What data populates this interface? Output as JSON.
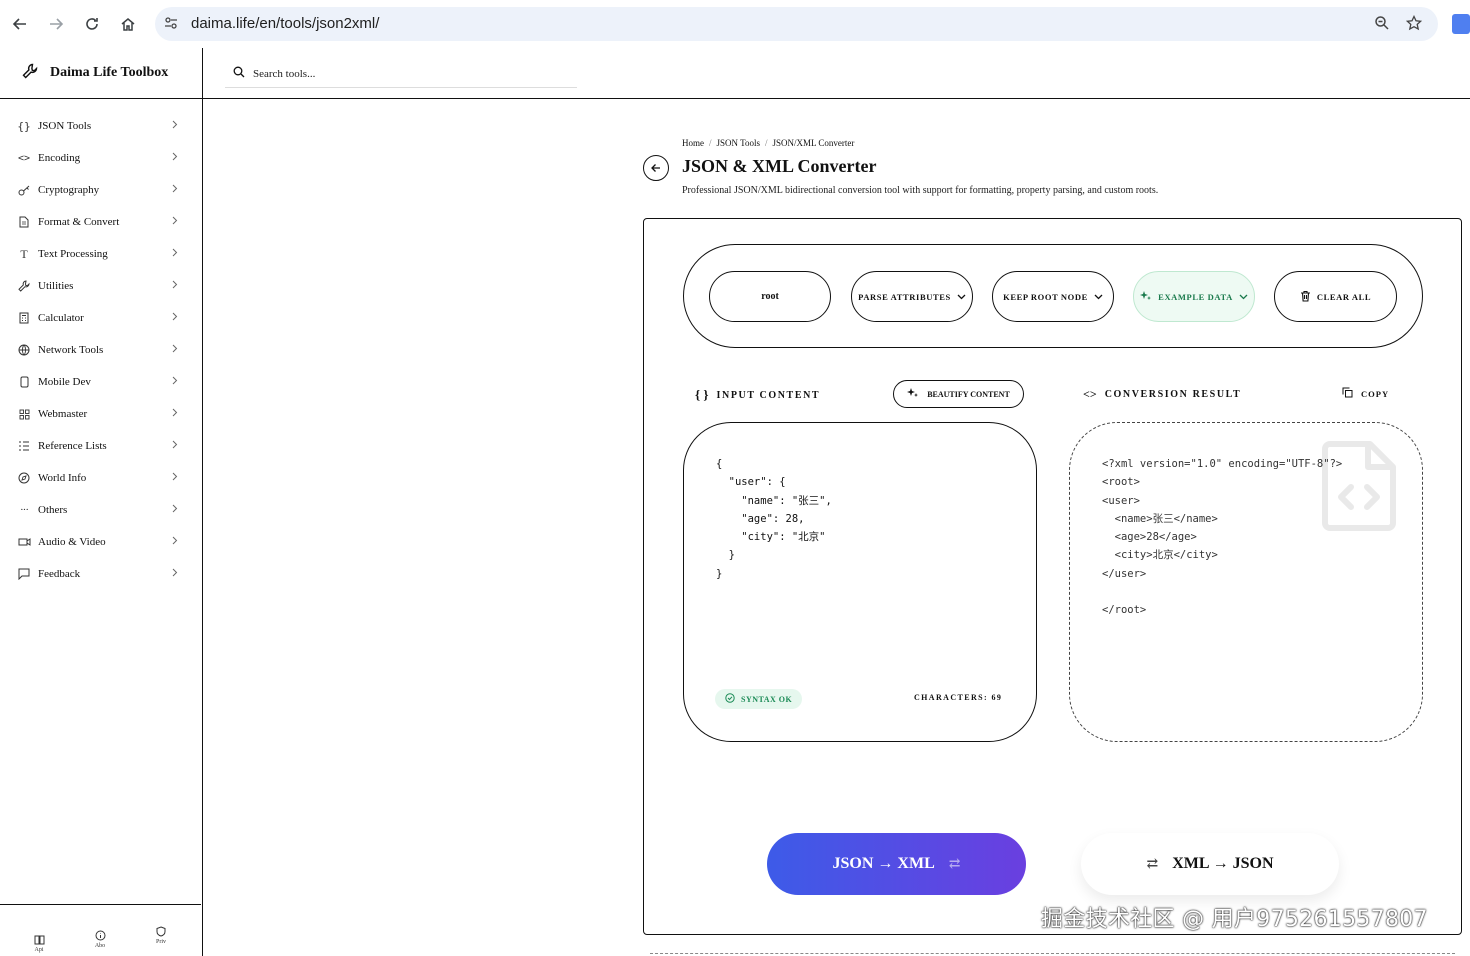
{
  "browser": {
    "url": "daima.life/en/tools/json2xml/"
  },
  "app": {
    "brand": "Daima Life Toolbox",
    "search_placeholder": "Search tools..."
  },
  "sidebar": {
    "items": [
      {
        "label": "JSON Tools",
        "icon": "braces-icon"
      },
      {
        "label": "Encoding",
        "icon": "code-icon"
      },
      {
        "label": "Cryptography",
        "icon": "key-icon"
      },
      {
        "label": "Format & Convert",
        "icon": "file-icon"
      },
      {
        "label": "Text Processing",
        "icon": "text-icon"
      },
      {
        "label": "Utilities",
        "icon": "wrench-icon"
      },
      {
        "label": "Calculator",
        "icon": "calculator-icon"
      },
      {
        "label": "Network Tools",
        "icon": "globe-icon"
      },
      {
        "label": "Mobile Dev",
        "icon": "phone-icon"
      },
      {
        "label": "Webmaster",
        "icon": "grid-icon"
      },
      {
        "label": "Reference Lists",
        "icon": "list-icon"
      },
      {
        "label": "World Info",
        "icon": "compass-icon"
      },
      {
        "label": "Others",
        "icon": "dots-icon"
      },
      {
        "label": "Audio & Video",
        "icon": "video-icon"
      },
      {
        "label": "Feedback",
        "icon": "message-icon"
      }
    ],
    "bottom": [
      {
        "label": "Api",
        "icon": "book-icon"
      },
      {
        "label": "Abo",
        "icon": "info-icon"
      },
      {
        "label": "Priv",
        "icon": "shield-icon"
      }
    ]
  },
  "page": {
    "breadcrumb": [
      "Home",
      "JSON Tools",
      "JSON/XML Converter"
    ],
    "title": "JSON & XML Converter",
    "description": "Professional JSON/XML bidirectional conversion tool with support for formatting, property parsing, and custom roots."
  },
  "toolbar": {
    "root_value": "root",
    "parse_attributes": "PARSE ATTRIBUTES",
    "keep_root_node": "KEEP ROOT NODE",
    "example_data": "EXAMPLE DATA",
    "clear_all": "CLEAR ALL"
  },
  "input": {
    "label": "INPUT CONTENT",
    "beautify": "BEAUTIFY CONTENT",
    "content": "{\n  \"user\": {\n    \"name\": \"张三\",\n    \"age\": 28,\n    \"city\": \"北京\"\n  }\n}",
    "status": "SYNTAX OK",
    "characters": "CHARACTERS: 69"
  },
  "output": {
    "label": "CONVERSION RESULT",
    "copy": "COPY",
    "content": "<?xml version=\"1.0\" encoding=\"UTF-8\"?>\n<root>\n<user>\n  <name>张三</name>\n  <age>28</age>\n  <city>北京</city>\n</user>\n\n</root>"
  },
  "actions": {
    "json_to_xml": "JSON → XML",
    "xml_to_json": "XML → JSON"
  },
  "watermark": "掘金技术社区 @ 用户975261557807",
  "colors": {
    "accent_gradient_start": "#3d5be8",
    "accent_gradient_end": "#6a3fe0",
    "success": "#1a8a55"
  }
}
